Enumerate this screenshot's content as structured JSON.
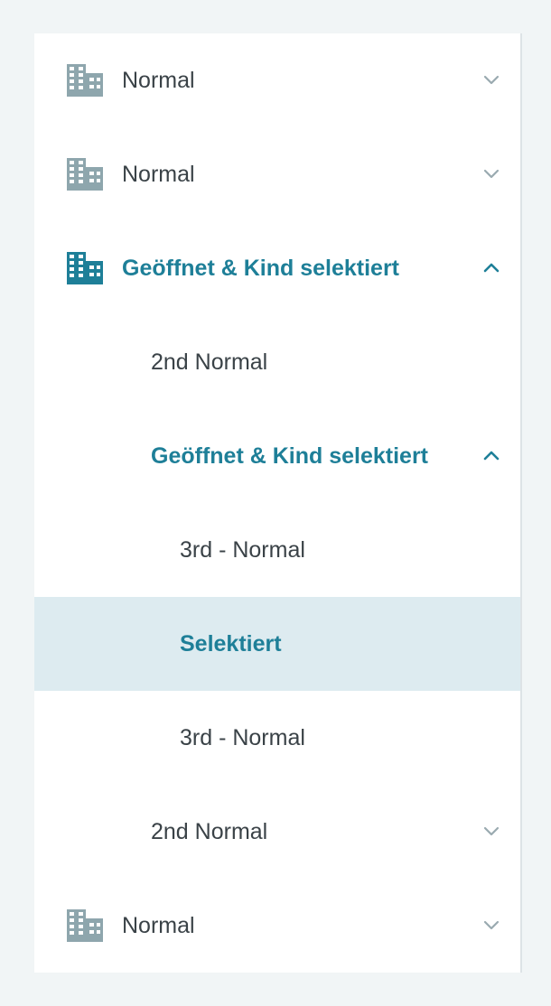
{
  "colors": {
    "page_background": "#f1f5f6",
    "panel_background": "#ffffff",
    "text_default": "#3a4247",
    "accent": "#1e7f98",
    "icon_default": "#8ea6ad",
    "chevron_default": "#9aaab0",
    "selected_background": "#ddebf0"
  },
  "tree": [
    {
      "label": "Normal",
      "level": 1,
      "icon": "building-icon",
      "chevron": "chevron-down-icon",
      "state": "collapsed"
    },
    {
      "label": "Normal",
      "level": 1,
      "icon": "building-icon",
      "chevron": "chevron-down-icon",
      "state": "collapsed"
    },
    {
      "label": "Geöffnet & Kind selektiert",
      "level": 1,
      "icon": "building-icon",
      "chevron": "chevron-up-icon",
      "state": "expanded-active"
    },
    {
      "label": "2nd Normal",
      "level": 2,
      "state": "leaf"
    },
    {
      "label": "Geöffnet & Kind selektiert",
      "level": 2,
      "chevron": "chevron-up-icon",
      "state": "expanded-active"
    },
    {
      "label": "3rd - Normal",
      "level": 3,
      "state": "leaf"
    },
    {
      "label": "Selektiert",
      "level": 3,
      "state": "selected"
    },
    {
      "label": "3rd - Normal",
      "level": 3,
      "state": "leaf"
    },
    {
      "label": "2nd Normal",
      "level": 2,
      "chevron": "chevron-down-icon",
      "state": "collapsed"
    },
    {
      "label": "Normal",
      "level": 1,
      "icon": "building-icon",
      "chevron": "chevron-down-icon",
      "state": "collapsed"
    }
  ]
}
